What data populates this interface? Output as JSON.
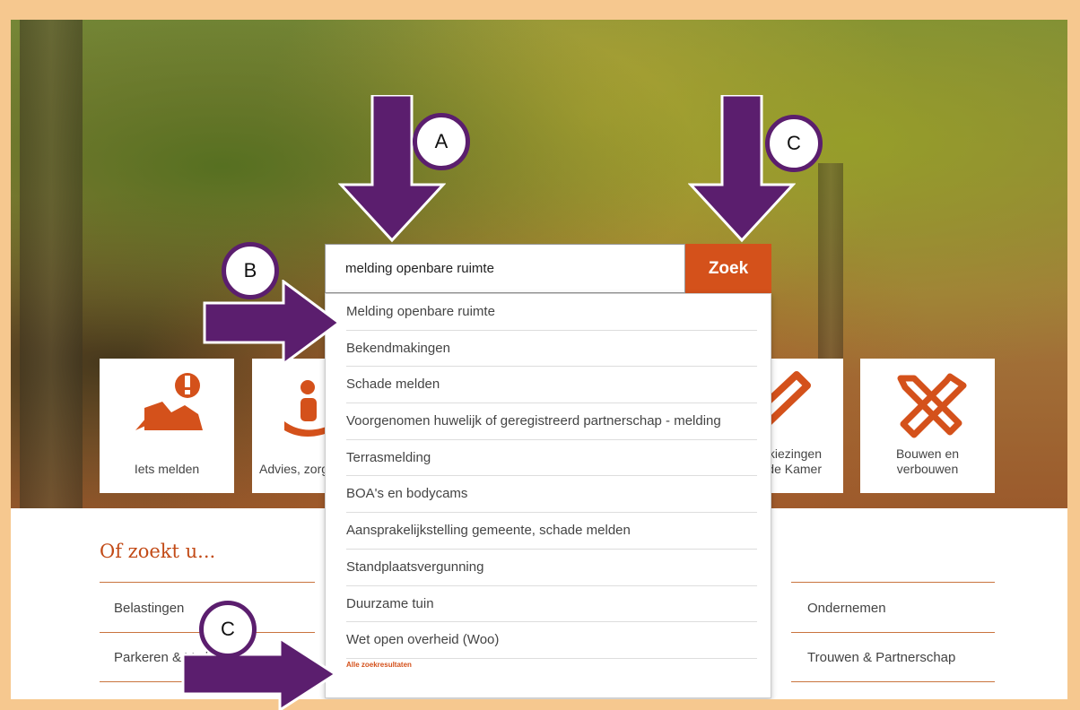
{
  "search": {
    "value": "melding openbare ruimte",
    "button_label": "Zoek"
  },
  "tiles": [
    {
      "label": "Iets melden"
    },
    {
      "label": "Advies, zorg"
    },
    {
      "label": "Verkiezingen Tweede Kamer"
    },
    {
      "label": "Bouwen en verbouwen"
    }
  ],
  "suggestions": [
    "Melding openbare ruimte",
    "Bekendmakingen",
    "Schade melden",
    "Voorgenomen huwelijk of geregistreerd partnerschap - melding",
    "Terrasmelding",
    "BOA's en bodycams",
    "Aansprakelijkstelling gemeente, schade melden",
    "Standplaatsvergunning",
    "Duurzame tuin",
    "Wet open overheid (Woo)"
  ],
  "all_results_label": "Alle zoekresultaten",
  "lower": {
    "heading": "Of zoekt u...",
    "links_left": [
      "Belastingen",
      "Parkeren & Verkeer"
    ],
    "links_right": [
      "Ondernemen",
      "Trouwen & Partnerschap"
    ]
  },
  "annotations": {
    "a": "A",
    "b": "B",
    "c1": "C",
    "c2": "C"
  },
  "colors": {
    "accent": "#d4511b",
    "annotation": "#5b1e6e"
  }
}
